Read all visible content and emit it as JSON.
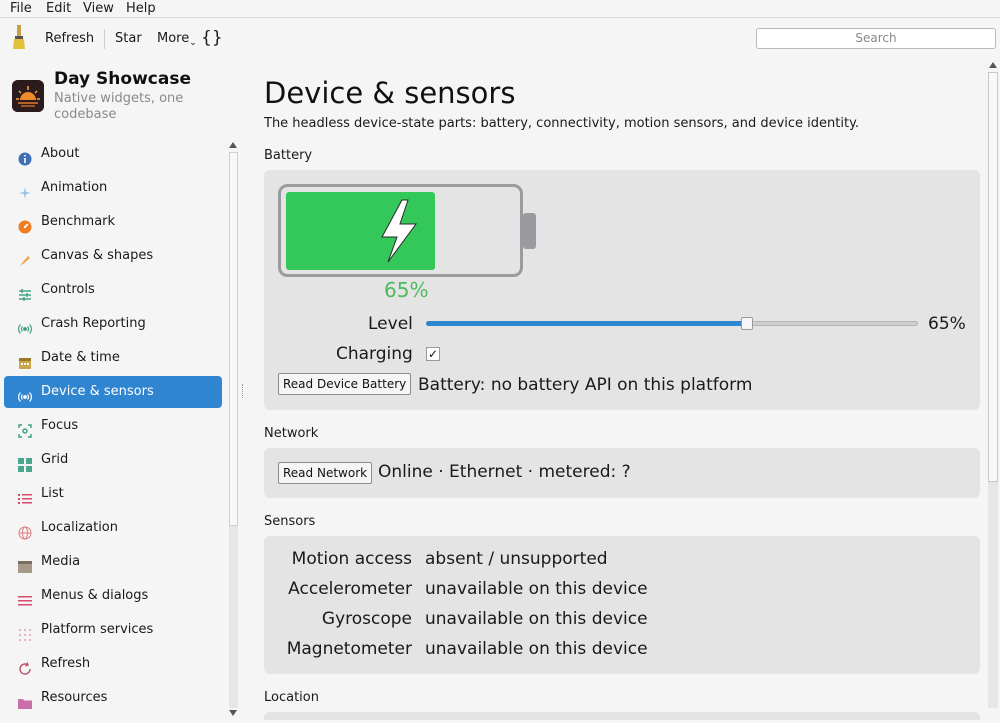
{
  "menubar": {
    "file": "File",
    "edit": "Edit",
    "view": "View",
    "help": "Help"
  },
  "toolbar": {
    "refresh": "Refresh",
    "star": "Star",
    "more": "More",
    "json": "{}",
    "search_placeholder": "Search"
  },
  "sidebar": {
    "app_title": "Day Showcase",
    "app_subtitle": "Native widgets, one codebase",
    "items": [
      {
        "label": "About",
        "icon": "info-icon"
      },
      {
        "label": "Animation",
        "icon": "sparkle-icon"
      },
      {
        "label": "Benchmark",
        "icon": "gauge-icon"
      },
      {
        "label": "Canvas & shapes",
        "icon": "brush-icon"
      },
      {
        "label": "Controls",
        "icon": "sliders-icon"
      },
      {
        "label": "Crash Reporting",
        "icon": "broadcast-icon"
      },
      {
        "label": "Date & time",
        "icon": "calendar-icon"
      },
      {
        "label": "Device & sensors",
        "icon": "broadcast-icon"
      },
      {
        "label": "Focus",
        "icon": "focus-icon"
      },
      {
        "label": "Grid",
        "icon": "grid-icon"
      },
      {
        "label": "List",
        "icon": "list-icon"
      },
      {
        "label": "Localization",
        "icon": "globe-icon"
      },
      {
        "label": "Media",
        "icon": "clapper-icon"
      },
      {
        "label": "Menus & dialogs",
        "icon": "menu-icon"
      },
      {
        "label": "Platform services",
        "icon": "dots-grid-icon"
      },
      {
        "label": "Refresh",
        "icon": "refresh-icon"
      },
      {
        "label": "Resources",
        "icon": "folder-icon"
      }
    ],
    "active_index": 7
  },
  "page": {
    "title": "Device & sensors",
    "description": "The headless device-state parts: battery, connectivity, motion sensors, and device identity.",
    "battery": {
      "section": "Battery",
      "percent_label": "65%",
      "level": 0.65,
      "level_label": "Level",
      "level_value": "65%",
      "charging_label": "Charging",
      "charging": true,
      "check_mark": "✓",
      "read_button": "Read Device Battery",
      "status": "Battery: no battery API on this platform"
    },
    "network": {
      "section": "Network",
      "read_button": "Read Network",
      "status": "Online · Ethernet · metered: ?"
    },
    "sensors": {
      "section": "Sensors",
      "rows": [
        {
          "name": "Motion access",
          "value": "absent / unsupported"
        },
        {
          "name": "Accelerometer",
          "value": "unavailable on this device"
        },
        {
          "name": "Gyroscope",
          "value": "unavailable on this device"
        },
        {
          "name": "Magnetometer",
          "value": "unavailable on this device"
        }
      ]
    },
    "location": {
      "section": "Location"
    }
  },
  "colors": {
    "accent": "#3085d0",
    "battery_green": "#34c759",
    "percent_green": "#4cbb5e"
  }
}
